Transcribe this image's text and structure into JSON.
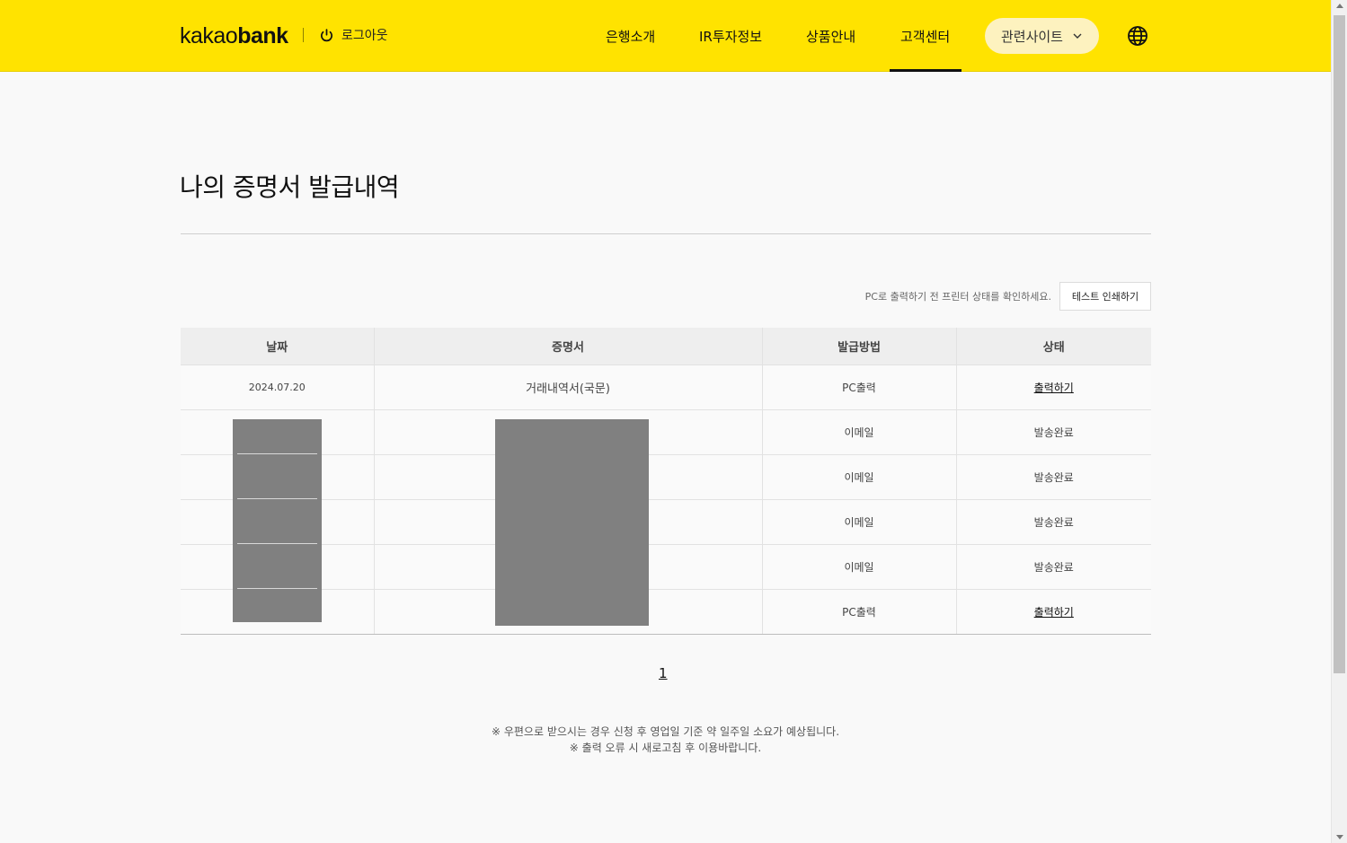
{
  "header": {
    "logo_kakao": "kakao",
    "logo_bank": "bank",
    "logout_label": "로그아웃",
    "nav": [
      "은행소개",
      "IR투자정보",
      "상품안내",
      "고객센터"
    ],
    "active_nav": "고객센터",
    "related_sites_label": "관련사이트",
    "bg_color": "#ffe300"
  },
  "main": {
    "title": "나의 증명서 발급내역",
    "printer_note": "PC로 출력하기 전 프린터 상태를 확인하세요.",
    "test_print_label": "테스트 인쇄하기",
    "table": {
      "headers": [
        "날짜",
        "증명서",
        "발급방법",
        "상태"
      ],
      "rows": [
        {
          "date": "2024.07.20",
          "certificate": "거래내역서(국문)",
          "method": "PC출력",
          "status": "출력하기",
          "status_link": true
        },
        {
          "date": "",
          "certificate": "",
          "method": "이메일",
          "status": "발송완료",
          "status_link": false
        },
        {
          "date": "",
          "certificate": "",
          "method": "이메일",
          "status": "발송완료",
          "status_link": false
        },
        {
          "date": "",
          "certificate": "",
          "method": "이메일",
          "status": "발송완료",
          "status_link": false
        },
        {
          "date": "",
          "certificate": "",
          "method": "이메일",
          "status": "발송완료",
          "status_link": false
        },
        {
          "date": "",
          "certificate": "",
          "method": "PC출력",
          "status": "출력하기",
          "status_link": true
        }
      ]
    },
    "pagination": {
      "current_page": "1"
    },
    "notices": [
      "※ 우편으로 받으시는 경우 신청 후 영업일 기준 약 일주일 소요가 예상됩니다.",
      "※ 출력 오류 시 새로고침 후 이용바랍니다."
    ]
  }
}
